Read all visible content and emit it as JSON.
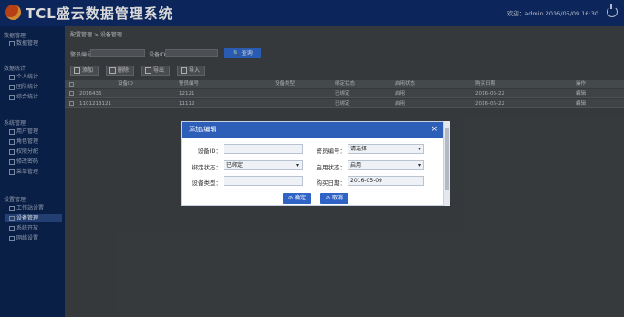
{
  "app": {
    "title": "TCL盛云数据管理系统",
    "user_info": "欢迎：admin  2016/05/09 16:30"
  },
  "sidebar": {
    "groups": [
      {
        "title": "数据管理",
        "items": [
          "数据管理"
        ]
      },
      {
        "title": "数据统计",
        "items": [
          "个人统计",
          "团队统计",
          "综合统计"
        ]
      },
      {
        "title": "系统管理",
        "items": [
          "用户管理",
          "角色管理",
          "权限分配",
          "修改密码",
          "菜单管理"
        ]
      },
      {
        "title": "设置管理",
        "items": [
          "工作站设置",
          "设备管理",
          "系统开放",
          "网络设置"
        ]
      }
    ]
  },
  "main": {
    "breadcrumb": "配置管理 > 设备管理",
    "search": {
      "label1": "警员编号",
      "label2": "设备ID",
      "query_label": "查询"
    },
    "actions": [
      "添加",
      "删除",
      "导出",
      "导入"
    ],
    "table": {
      "headers": [
        "设备ID",
        "警员编号",
        "设备类型",
        "绑定状态",
        "启用状态",
        "购买日期",
        "操作"
      ],
      "rows": [
        [
          "2016436",
          "12121",
          "",
          "已绑定",
          "启用",
          "2016-06-22",
          "编辑"
        ],
        [
          "1101213121",
          "11112",
          "",
          "已绑定",
          "启用",
          "2016-06-22",
          "编辑"
        ]
      ]
    }
  },
  "modal": {
    "title": "添加/编辑",
    "close": "×",
    "fields": {
      "device_id_label": "设备ID：",
      "device_id_value": "",
      "police_no_label": "警员编号：",
      "police_no_value": "请选择",
      "bind_label": "绑定状态：",
      "bind_value": "已绑定",
      "enable_label": "启用状态：",
      "enable_value": "启用",
      "type_label": "设备类型：",
      "type_value": "",
      "buy_label": "购买日期：",
      "buy_value": "2016-05-09"
    },
    "confirm_label": "⊘ 确定",
    "cancel_label": "⊘ 取消"
  }
}
